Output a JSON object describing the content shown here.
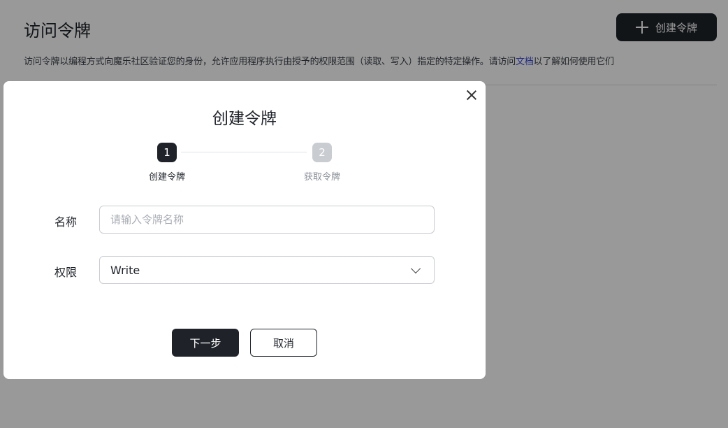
{
  "page": {
    "title": "访问令牌",
    "create_button_label": "创建令牌",
    "description_before_link": "访问令牌以编程方式向魔乐社区验证您的身份，允许应用程序执行由授予的权限范围（读取、写入）指定的特定操作。请访问",
    "description_link": "文档",
    "description_after_link": "以了解如何使用它们"
  },
  "modal": {
    "title": "创建令牌",
    "steps": [
      {
        "number": "1",
        "label": "创建令牌",
        "state": "active"
      },
      {
        "number": "2",
        "label": "获取令牌",
        "state": "inactive"
      }
    ],
    "form": {
      "name_label": "名称",
      "name_placeholder": "请输入令牌名称",
      "name_value": "",
      "permission_label": "权限",
      "permission_value": "Write"
    },
    "next_button_label": "下一步",
    "cancel_button_label": "取消"
  },
  "icons": {
    "plus": "plus-icon",
    "close": "close-icon",
    "chevron": "chevron-down-icon"
  },
  "colors": {
    "primary_dark": "#1f2329",
    "link": "#3b4ad8",
    "step_inactive": "#c9ccd1",
    "overlay": "rgba(0,0,0,0.4)"
  }
}
